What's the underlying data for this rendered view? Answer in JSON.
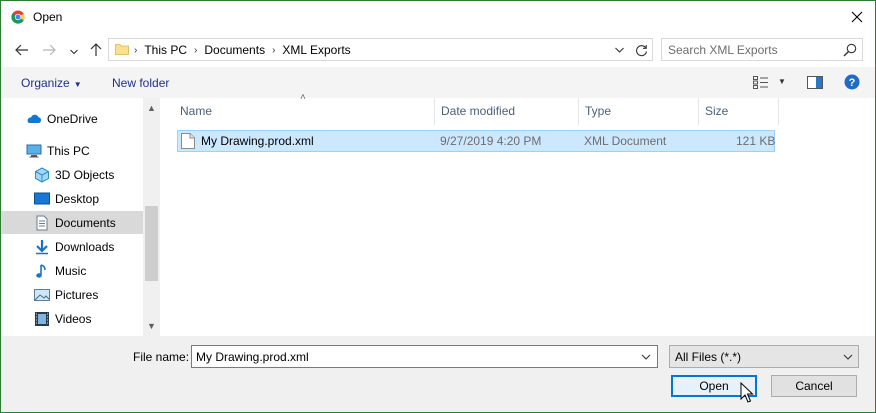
{
  "window": {
    "title": "Open"
  },
  "address": {
    "crumbs": [
      "This PC",
      "Documents",
      "XML Exports"
    ]
  },
  "search": {
    "placeholder": "Search XML Exports"
  },
  "toolbar": {
    "organize_label": "Organize",
    "new_folder_label": "New folder"
  },
  "nav": {
    "items": [
      {
        "label": "OneDrive",
        "icon": "onedrive-icon"
      },
      {
        "label": "This PC",
        "icon": "computer-icon"
      },
      {
        "label": "3D Objects",
        "icon": "3d-objects-icon"
      },
      {
        "label": "Desktop",
        "icon": "desktop-icon"
      },
      {
        "label": "Documents",
        "icon": "documents-icon",
        "selected": true
      },
      {
        "label": "Downloads",
        "icon": "downloads-icon"
      },
      {
        "label": "Music",
        "icon": "music-icon"
      },
      {
        "label": "Pictures",
        "icon": "pictures-icon"
      },
      {
        "label": "Videos",
        "icon": "videos-icon"
      }
    ]
  },
  "files": {
    "columns": [
      "Name",
      "Date modified",
      "Type",
      "Size"
    ],
    "rows": [
      {
        "name": "My Drawing.prod.xml",
        "date": "9/27/2019 4:20 PM",
        "type": "XML Document",
        "size": "121 KB",
        "selected": true
      }
    ]
  },
  "bottom": {
    "file_name_label": "File name:",
    "file_name_value": "My Drawing.prod.xml",
    "filter_value": "All Files (*.*)",
    "open_label": "Open",
    "cancel_label": "Cancel"
  },
  "colors": {
    "accent": "#0078d7",
    "selection": "#cce8ff",
    "link": "#1e3287",
    "frame": "#2e7d32"
  }
}
